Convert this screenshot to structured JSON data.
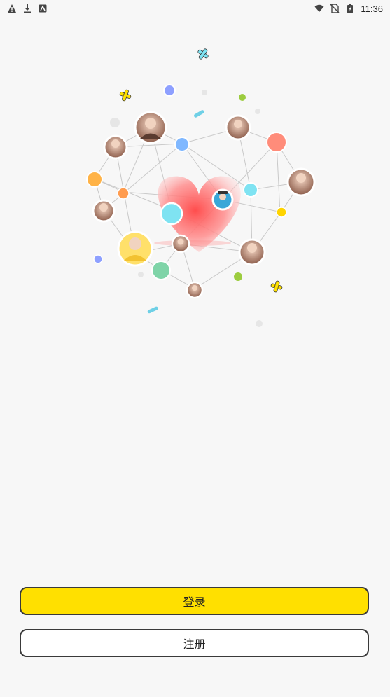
{
  "status_bar": {
    "time": "11:36",
    "left_icons": [
      "warning-icon",
      "download-icon",
      "app-notification-icon"
    ],
    "right_icons": [
      "wifi-icon",
      "no-sim-icon",
      "battery-icon"
    ]
  },
  "hero": {
    "illustration": "social-network-heart",
    "colors": {
      "heart": "#ff6e6e",
      "cyan": "#7fe3f2",
      "orange": "#ffb347",
      "green": "#7fd4a8",
      "blue": "#80b8ff",
      "purple": "#8ea0ff",
      "yellow": "#ffe000",
      "coral": "#ff8c7a"
    }
  },
  "actions": {
    "login_label": "登录",
    "register_label": "注册"
  },
  "theme": {
    "background": "#f7f7f7",
    "primary": "#ffe000",
    "border": "#3a3a3a"
  }
}
